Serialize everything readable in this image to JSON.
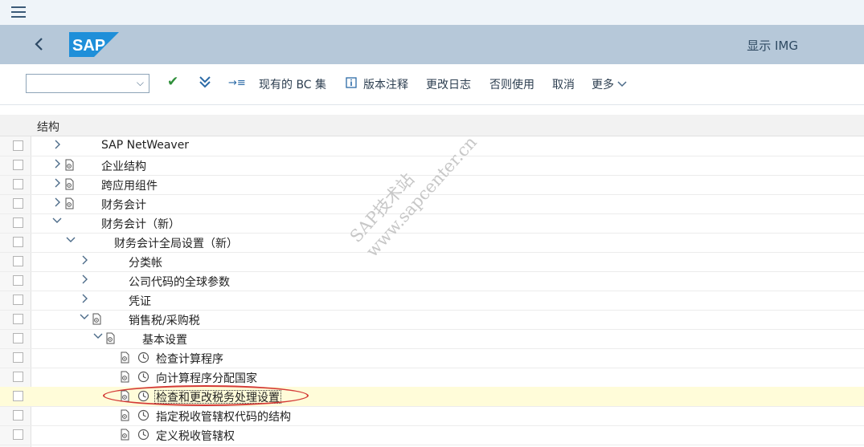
{
  "window": {
    "title": "显示 IMG"
  },
  "toolbar": {
    "combo_value": "",
    "check_icon": "check-icon",
    "expand_all_icon": "double-chevron-down-icon",
    "tree_icon": "indent-icon",
    "bc_sets": "现有的 BC 集",
    "release_notes": "版本注释",
    "change_log": "更改日志",
    "else_use": "否则使用",
    "cancel": "取消",
    "more": "更多"
  },
  "tree": {
    "header": "结构",
    "rows": [
      {
        "label": "SAP NetWeaver",
        "expander": ">",
        "doc": false
      },
      {
        "label": "企业结构",
        "expander": ">",
        "doc": true
      },
      {
        "label": "跨应用组件",
        "expander": ">",
        "doc": true
      },
      {
        "label": "财务会计",
        "expander": ">",
        "doc": true
      },
      {
        "label": "财务会计（新）",
        "expander": "v",
        "doc": false
      },
      {
        "label": "财务会计全局设置（新）",
        "expander": "v",
        "doc": false
      },
      {
        "label": "分类帐",
        "expander": ">",
        "doc": false
      },
      {
        "label": "公司代码的全球参数",
        "expander": ">",
        "doc": false
      },
      {
        "label": "凭证",
        "expander": ">",
        "doc": false
      },
      {
        "label": "销售税/采购税",
        "expander": "v",
        "doc": true
      },
      {
        "label": "基本设置",
        "expander": "v",
        "doc": true
      },
      {
        "label": "检查计算程序",
        "doc": true,
        "clock": true
      },
      {
        "label": "向计算程序分配国家",
        "doc": true,
        "clock": true
      },
      {
        "label": "检查和更改税务处理设置",
        "doc": true,
        "clock": true,
        "selected": true
      },
      {
        "label": "指定税收管辖权代码的结构",
        "doc": true,
        "clock": true
      },
      {
        "label": "定义税收管辖权",
        "doc": true,
        "clock": true
      }
    ]
  },
  "watermark": {
    "line1": "SAP技术站",
    "line2": "www.sapcenter.cn"
  },
  "colors": {
    "header_bg": "#b6c8d9",
    "accent": "#2b6aa6",
    "highlight": "#d43a36",
    "selected_row": "#fffcd9"
  }
}
